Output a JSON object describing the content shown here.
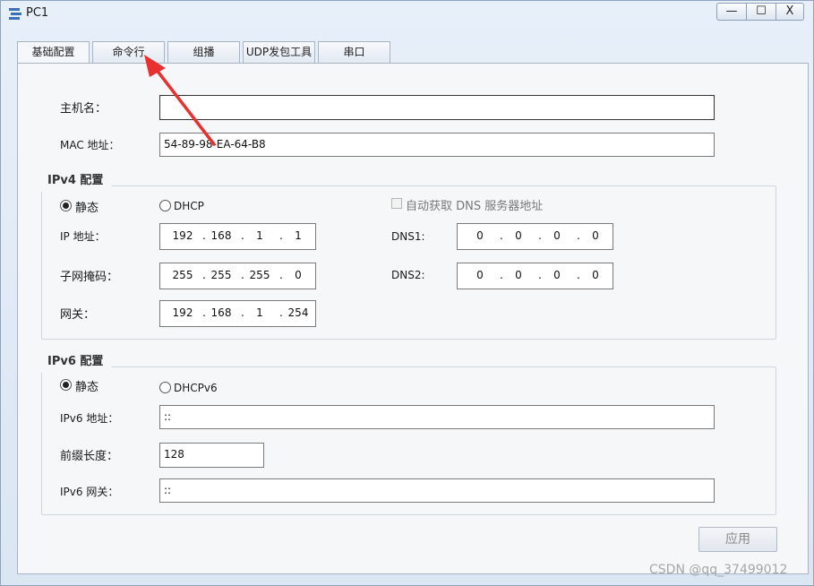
{
  "window": {
    "title": "PC1",
    "minimize": "—",
    "maximize": "☐",
    "close": "X"
  },
  "tabs": [
    {
      "label": "基础配置",
      "active": true
    },
    {
      "label": "命令行",
      "active": false
    },
    {
      "label": "组播",
      "active": false
    },
    {
      "label": "UDP发包工具",
      "active": false
    },
    {
      "label": "串口",
      "active": false
    }
  ],
  "form": {
    "hostname_label": "主机名：",
    "hostname_value": "",
    "mac_label": "MAC 地址：",
    "mac_value": "54-89-98-EA-64-B8"
  },
  "ipv4": {
    "title": "IPv4 配置",
    "static_label": "静态",
    "static_selected": true,
    "dhcp_label": "DHCP",
    "dhcp_selected": false,
    "auto_dns_label": "自动获取 DNS 服务器地址",
    "auto_dns_checked": false,
    "ip_label": "IP 地址：",
    "ip": [
      "192",
      "168",
      "1",
      "1"
    ],
    "mask_label": "子网掩码：",
    "mask": [
      "255",
      "255",
      "255",
      "0"
    ],
    "gateway_label": "网关：",
    "gateway": [
      "192",
      "168",
      "1",
      "254"
    ],
    "dns1_label": "DNS1:",
    "dns1": [
      "0",
      "0",
      "0",
      "0"
    ],
    "dns2_label": "DNS2:",
    "dns2": [
      "0",
      "0",
      "0",
      "0"
    ]
  },
  "ipv6": {
    "title": "IPv6 配置",
    "static_label": "静态",
    "static_selected": true,
    "dhcp_label": "DHCPv6",
    "dhcp_selected": false,
    "addr_label": "IPv6 地址：",
    "addr_value": "::",
    "prefix_label": "前缀长度：",
    "prefix_value": "128",
    "gateway_label": "IPv6 网关：",
    "gateway_value": "::"
  },
  "apply_label": "应用",
  "watermark": "CSDN @qq_37499012",
  "colors": {
    "annotation_arrow": "#e8312f",
    "window_bg": "#dfe9f5",
    "panel_bg": "#f6f7f9"
  }
}
